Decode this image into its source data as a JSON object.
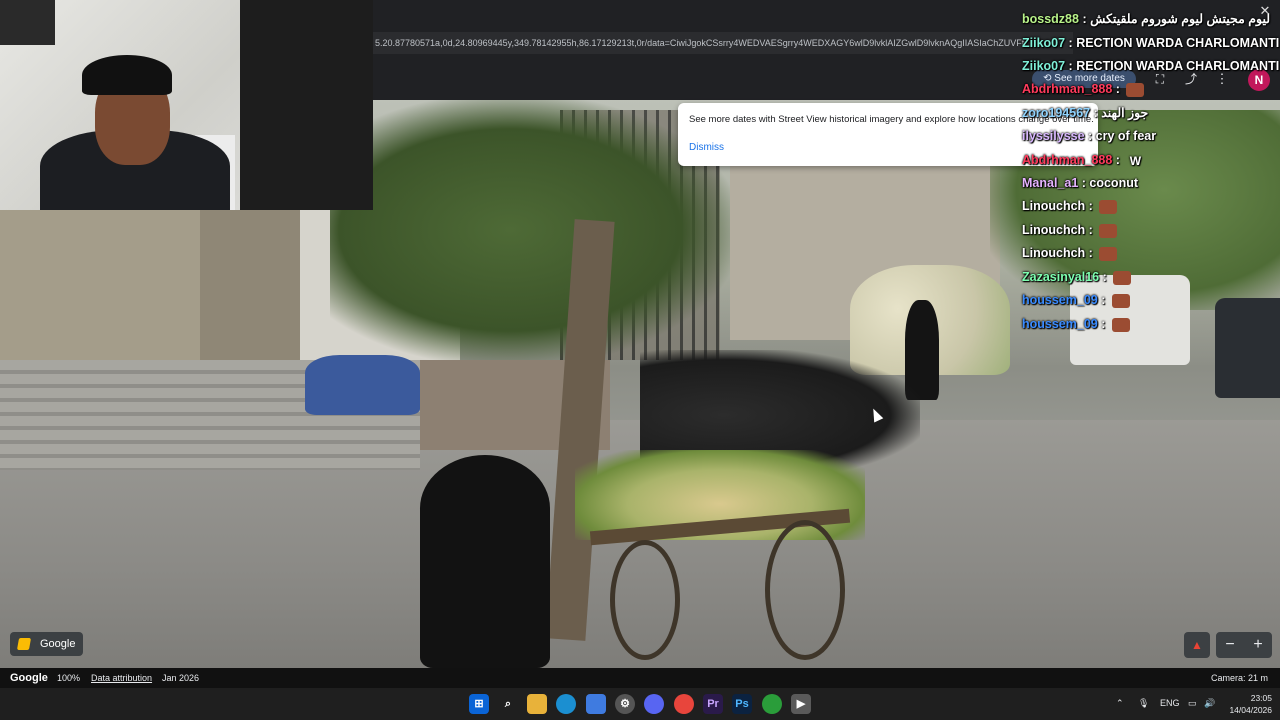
{
  "browser": {
    "url": "5.20.87780571a,0d,24.80969445y,349.78142955h,86.17129213t,0r/data=CiwiJgokCSsrry4WEDVAESgrry4WEDXAGY6wlD9lvklAIZGwlD9lvknAQgIIASIaChZUVFt"
  },
  "street_view": {
    "see_more_dates_label": "See more dates",
    "expand_icon": "expand-icon",
    "share_icon": "share-icon",
    "menu_icon": "kebab-menu-icon",
    "avatar_initial": "N",
    "avatar_color": "#c2185b",
    "popup": {
      "text": "See more dates with Street View historical imagery and explore how locations change over time.",
      "dismiss_label": "Dismiss"
    },
    "google_chip_label": "Google",
    "compass_icon": "compass-icon",
    "zoom_out_label": "−",
    "zoom_in_label": "+"
  },
  "info_bar": {
    "logo": "Google",
    "zoom": "100%",
    "attribution": "Data attribution",
    "date": "Jan 2026",
    "camera": "Camera: 21 m"
  },
  "chat": {
    "messages": [
      {
        "user": "bossdz88",
        "color": "#b8f28a",
        "text": "ليوم مجيتش ليوم شوروم ملقيتكش"
      },
      {
        "user": "Ziiko07",
        "color": "#7ff0d8",
        "text": "RECTION WARDA CHARLOMANTI"
      },
      {
        "user": "Ziiko07",
        "color": "#7ff0d8",
        "text": "RECTION WARDA CHARLOMANTI"
      },
      {
        "user": "Abdrhman_888",
        "color": "#ff3b5c",
        "text": ""
      },
      {
        "user": "zoro194567",
        "color": "#8fd3ff",
        "text": "جوز الهند"
      },
      {
        "user": "ilyssilysse",
        "color": "#d9b8ff",
        "text": "cry of fear"
      },
      {
        "user": "Abdrhman_888",
        "color": "#ff3b5c",
        "text": ""
      },
      {
        "user": "Manal_a1",
        "color": "#e6b3ff",
        "text": "coconut"
      },
      {
        "user": "Linouchch",
        "color": "#ffffff",
        "text": ""
      },
      {
        "user": "Linouchch",
        "color": "#ffffff",
        "text": ""
      },
      {
        "user": "Linouchch",
        "color": "#ffffff",
        "text": ""
      },
      {
        "user": "Zazasinyal16",
        "color": "#7dffb0",
        "text": ""
      },
      {
        "user": "houssem_09",
        "color": "#3b8cff",
        "text": ""
      },
      {
        "user": "houssem_09",
        "color": "#3b8cff",
        "text": ""
      }
    ],
    "separator": " : ",
    "emote_w": "W"
  },
  "taskbar": {
    "icons": [
      "windows-start-icon",
      "search-icon",
      "file-explorer-icon",
      "edge-icon",
      "store-icon",
      "settings-icon",
      "discord-icon",
      "chrome-icon",
      "premiere-icon",
      "photoshop-icon",
      "app-green-icon",
      "media-player-icon"
    ],
    "language": "ENG",
    "time": "23:05",
    "date": "14/04/2026"
  }
}
